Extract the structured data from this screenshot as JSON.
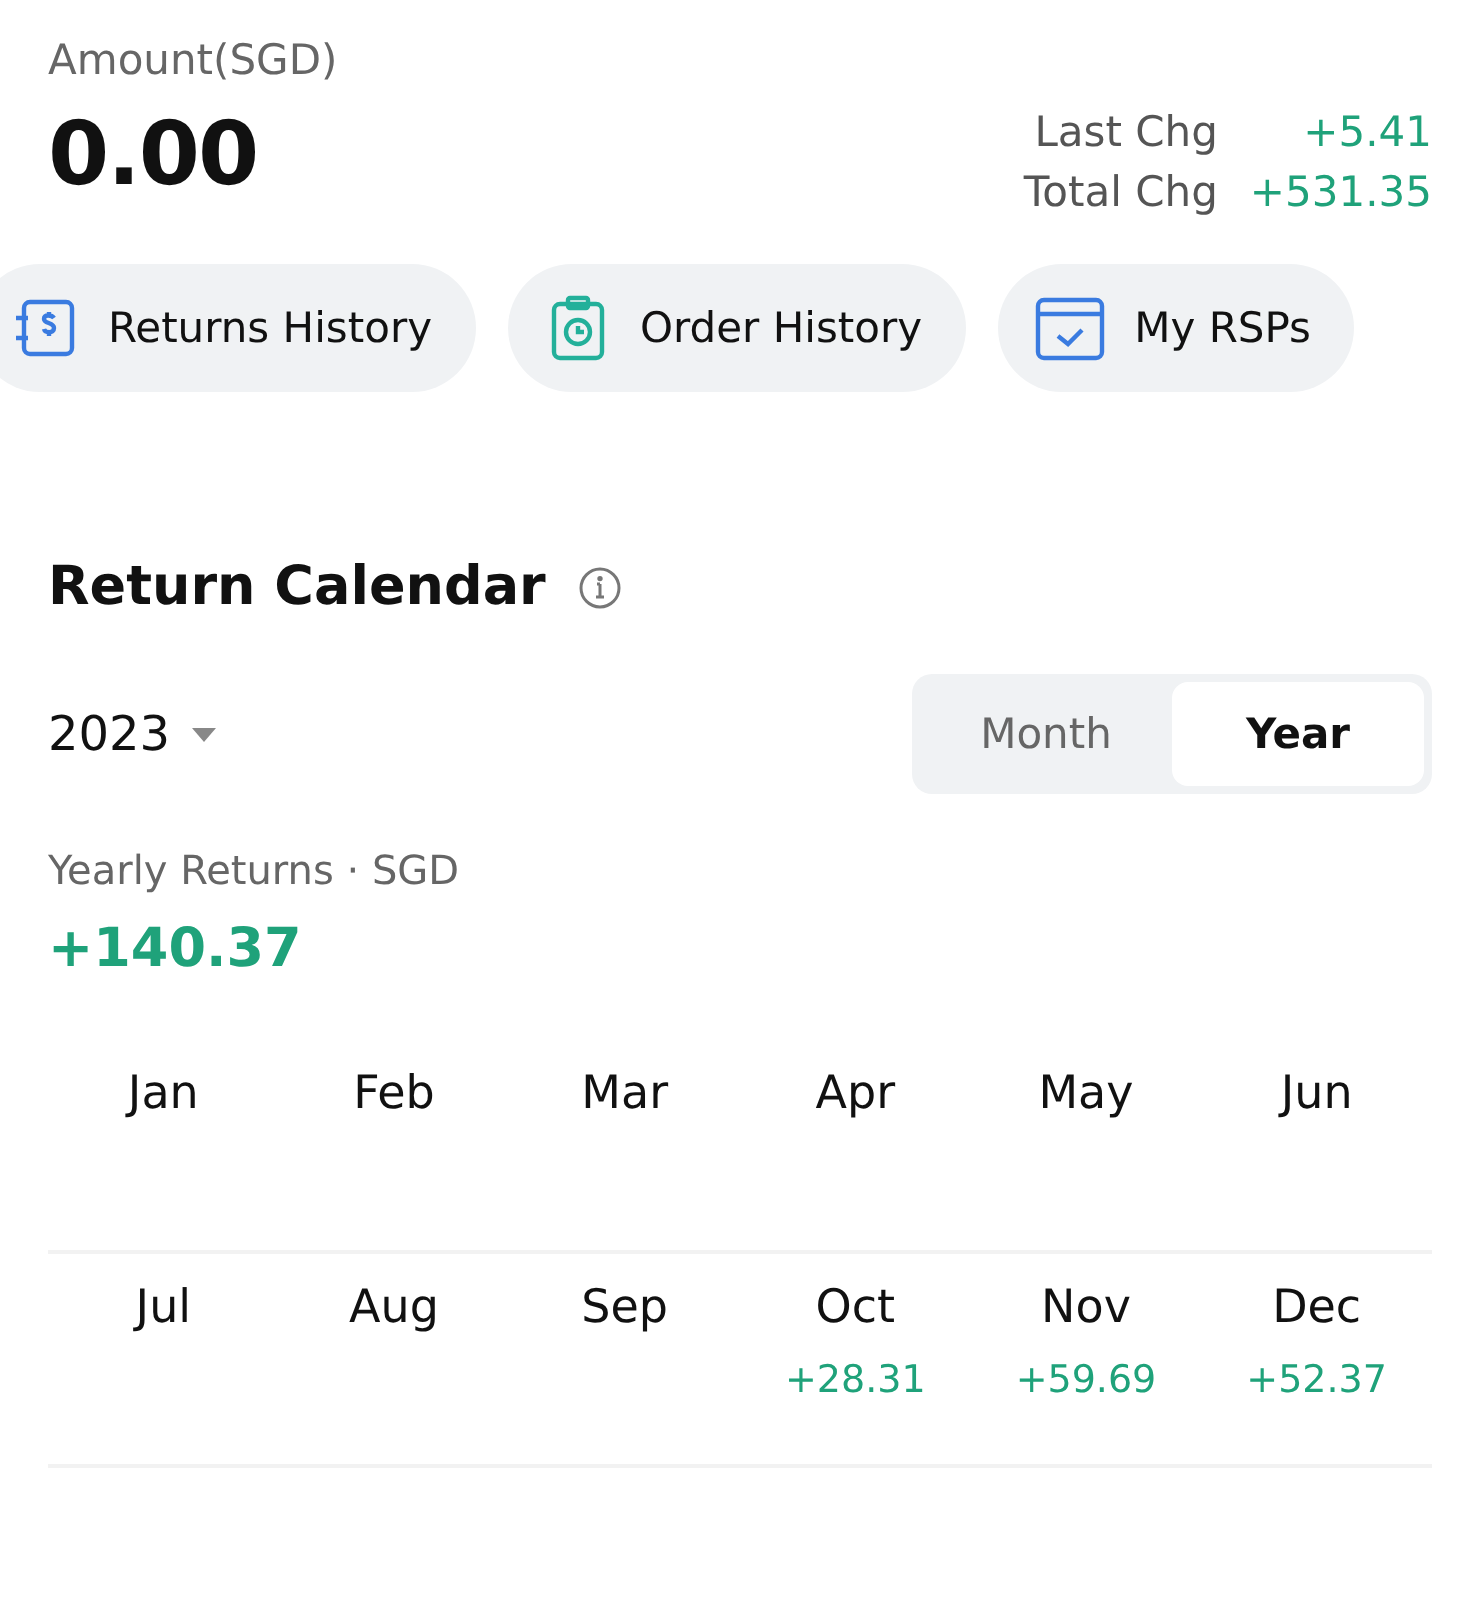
{
  "summary": {
    "amount_label": "Amount(SGD)",
    "amount": "0.00",
    "changes": [
      {
        "label": "Last Chg",
        "value": "+5.41"
      },
      {
        "label": "Total Chg",
        "value": "+531.35"
      }
    ]
  },
  "quick_actions": [
    {
      "label": "Returns History",
      "kind": "dollar"
    },
    {
      "label": "Order History",
      "kind": "clock"
    },
    {
      "label": "My RSPs",
      "kind": "calendar"
    }
  ],
  "calendar": {
    "title": "Return Calendar",
    "year": "2023",
    "periods": [
      {
        "label": "Month",
        "selected": false
      },
      {
        "label": "Year",
        "selected": true
      }
    ],
    "returns_label": "Yearly Returns · SGD",
    "returns_value": "+140.37",
    "months": [
      {
        "name": "Jan"
      },
      {
        "name": "Feb"
      },
      {
        "name": "Mar"
      },
      {
        "name": "Apr"
      },
      {
        "name": "May"
      },
      {
        "name": "Jun"
      },
      {
        "name": "Jul"
      },
      {
        "name": "Aug"
      },
      {
        "name": "Sep"
      },
      {
        "name": "Oct",
        "value": "+28.31"
      },
      {
        "name": "Nov",
        "value": "+59.69"
      },
      {
        "name": "Dec",
        "value": "+52.37"
      }
    ]
  }
}
